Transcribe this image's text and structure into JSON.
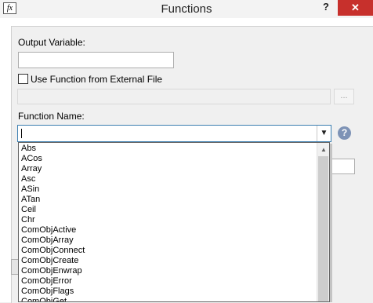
{
  "window": {
    "title": "Functions",
    "app_icon_glyph": "fx",
    "help_glyph": "?",
    "close_glyph": "✕"
  },
  "form": {
    "output_variable_label": "Output Variable:",
    "output_variable_value": "",
    "external_file_label": "Use Function from External File",
    "external_file_checked": false,
    "external_file_path": "",
    "browse_label": "...",
    "function_name_label": "Function Name:",
    "function_name_value": "",
    "function_help_glyph": "?"
  },
  "dropdown": {
    "items": [
      "Abs",
      "ACos",
      "Array",
      "Asc",
      "ASin",
      "ATan",
      "Ceil",
      "Chr",
      "ComObjActive",
      "ComObjArray",
      "ComObjConnect",
      "ComObjCreate",
      "ComObjEnwrap",
      "ComObjError",
      "ComObjFlags",
      "ComObjGet"
    ],
    "arrow_glyph": "▼",
    "scroll_up_glyph": "▲"
  },
  "colors": {
    "close_button": "#c7302c",
    "focus_border": "#3c7fb1",
    "help_circle": "#7e93b6"
  }
}
